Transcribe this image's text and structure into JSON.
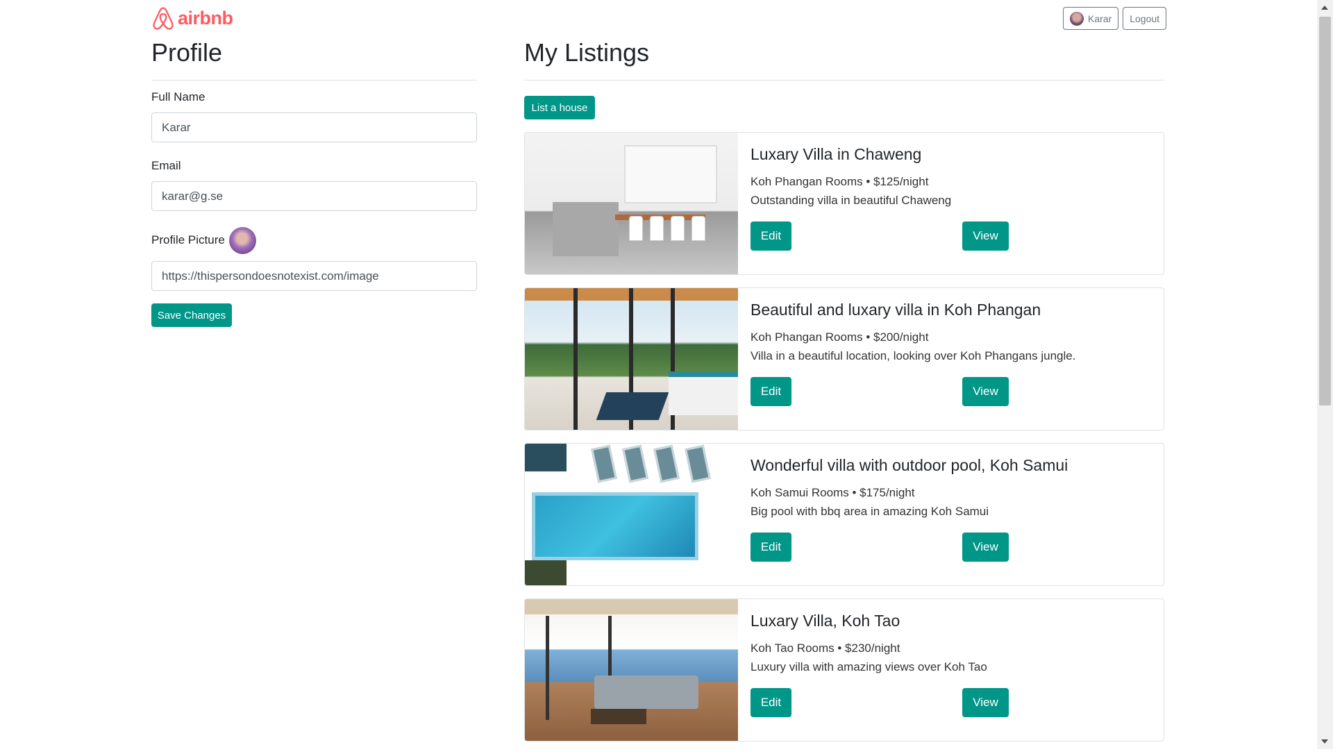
{
  "brand": {
    "name": "airbnb",
    "color": "#ff5a5f"
  },
  "header": {
    "user_name": "Karar",
    "logout_label": "Logout"
  },
  "profile": {
    "title": "Profile",
    "full_name_label": "Full Name",
    "full_name_value": "Karar",
    "email_label": "Email",
    "email_value": "karar@g.se",
    "picture_label": "Profile Picture",
    "picture_value": "https://thispersondoesnotexist.com/image",
    "save_label": "Save Changes"
  },
  "listings": {
    "title": "My Listings",
    "add_label": "List a house",
    "edit_label": "Edit",
    "view_label": "View",
    "items": [
      {
        "title": "Luxary Villa in Chaweng",
        "meta": "Koh Phangan Rooms • $125/night",
        "description": "Outstanding villa in beautiful Chaweng"
      },
      {
        "title": "Beautiful and luxary villa in Koh Phangan",
        "meta": "Koh Phangan Rooms • $200/night",
        "description": "Villa in a beautiful location, looking over Koh Phangans jungle."
      },
      {
        "title": "Wonderful villa with outdoor pool, Koh Samui",
        "meta": "Koh Samui Rooms • $175/night",
        "description": "Big pool with bbq area in amazing Koh Samui"
      },
      {
        "title": "Luxary Villa, Koh Tao",
        "meta": "Koh Tao Rooms • $230/night",
        "description": "Luxury villa with amazing views over Koh Tao"
      }
    ]
  },
  "colors": {
    "accent": "#009688",
    "border": "#dee2e6"
  }
}
